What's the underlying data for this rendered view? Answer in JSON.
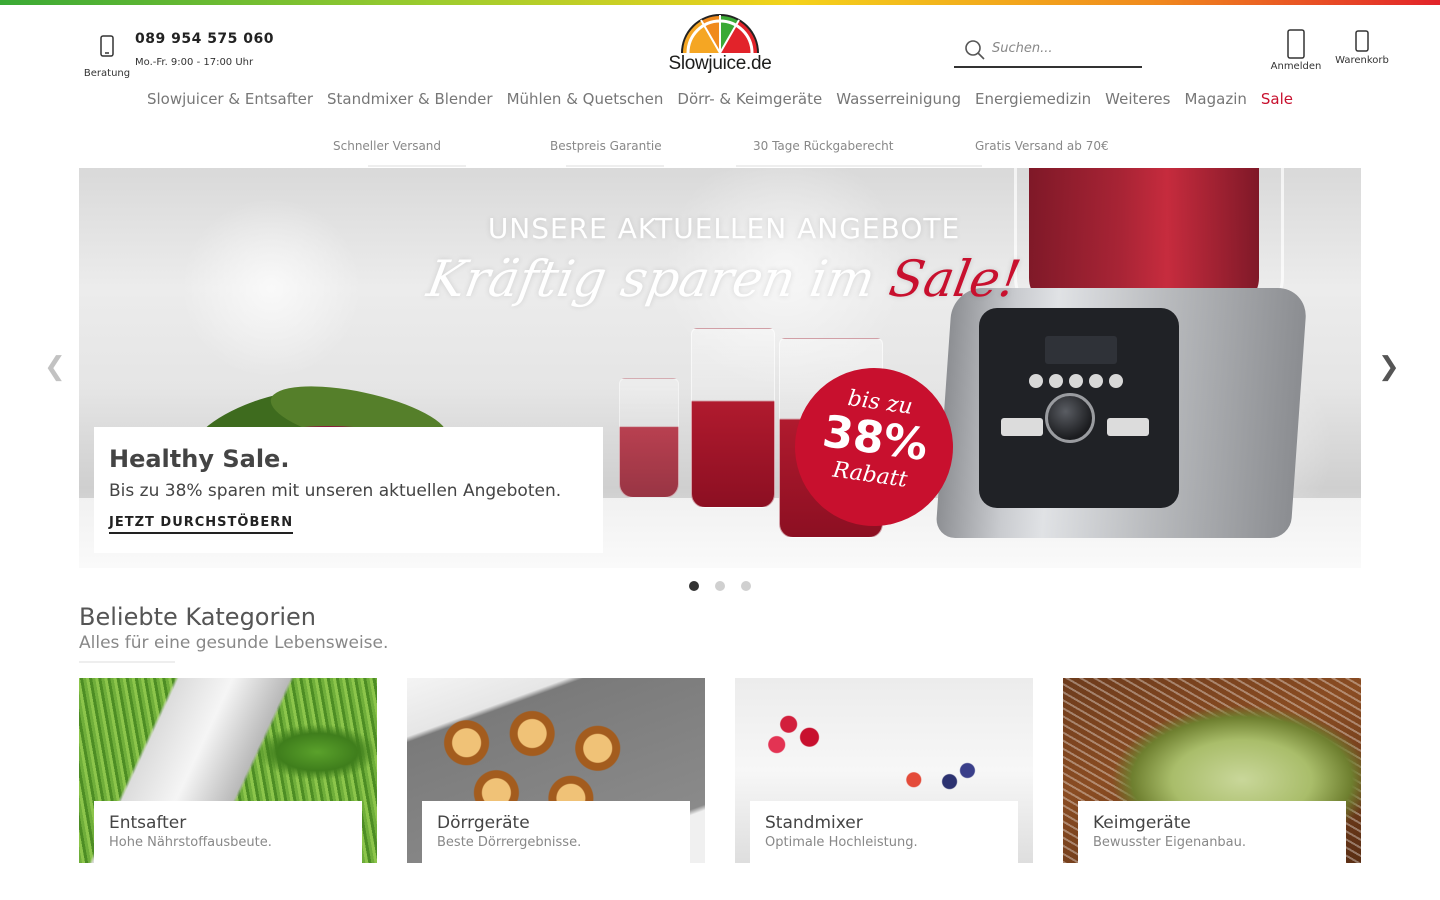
{
  "header": {
    "contact": {
      "icon": "phone-icon",
      "label": "Beratung",
      "phone": "089 954 575 060",
      "hours": "Mo.-Fr. 9:00 - 17:00 Uhr"
    },
    "logo_text": "Slowjuice.de",
    "search": {
      "placeholder": "Suchen...",
      "icon": "search-icon"
    },
    "account_label": "Anmelden",
    "cart_label": "Warenkorb"
  },
  "nav": {
    "items": [
      {
        "label": "Slowjuicer & Entsafter"
      },
      {
        "label": "Standmixer & Blender"
      },
      {
        "label": "Mühlen & Quetschen"
      },
      {
        "label": "Dörr- & Keimgeräte"
      },
      {
        "label": "Wasserreinigung"
      },
      {
        "label": "Energiemedizin"
      },
      {
        "label": "Weiteres"
      },
      {
        "label": "Magazin"
      },
      {
        "label": "Sale"
      }
    ]
  },
  "usp": [
    {
      "label": "Schneller Versand"
    },
    {
      "label": "Bestpreis Garantie"
    },
    {
      "label": "30 Tage Rückgaberecht"
    },
    {
      "label": "Gratis Versand ab 70€"
    }
  ],
  "hero": {
    "headline": "UNSERE AKTUELLEN ANGEBOTE",
    "script_text": "Kräftig sparen im ",
    "script_sale": "Sale!",
    "badge": {
      "line1": "bis zu",
      "line2": "38%",
      "line3": "Rabatt"
    },
    "card": {
      "title": "Healthy Sale.",
      "subtitle": "Bis zu 38% sparen mit unseren aktuellen Angeboten.",
      "cta": "JETZT DURCHSTÖBERN"
    },
    "slides_total": 3,
    "active_slide": 1
  },
  "categories": {
    "title": "Beliebte Kategorien",
    "subtitle": "Alles für eine gesunde Lebensweise.",
    "items": [
      {
        "name": "Entsafter",
        "desc": "Hohe Nährstoffausbeute."
      },
      {
        "name": "Dörrgeräte",
        "desc": "Beste Dörrergebnisse."
      },
      {
        "name": "Standmixer",
        "desc": "Optimale Hochleistung."
      },
      {
        "name": "Keimgeräte",
        "desc": "Bewusster Eigenanbau."
      }
    ]
  },
  "colors": {
    "accent_sale": "#c8102e",
    "text_dark": "#333333",
    "text_muted": "#888888"
  }
}
